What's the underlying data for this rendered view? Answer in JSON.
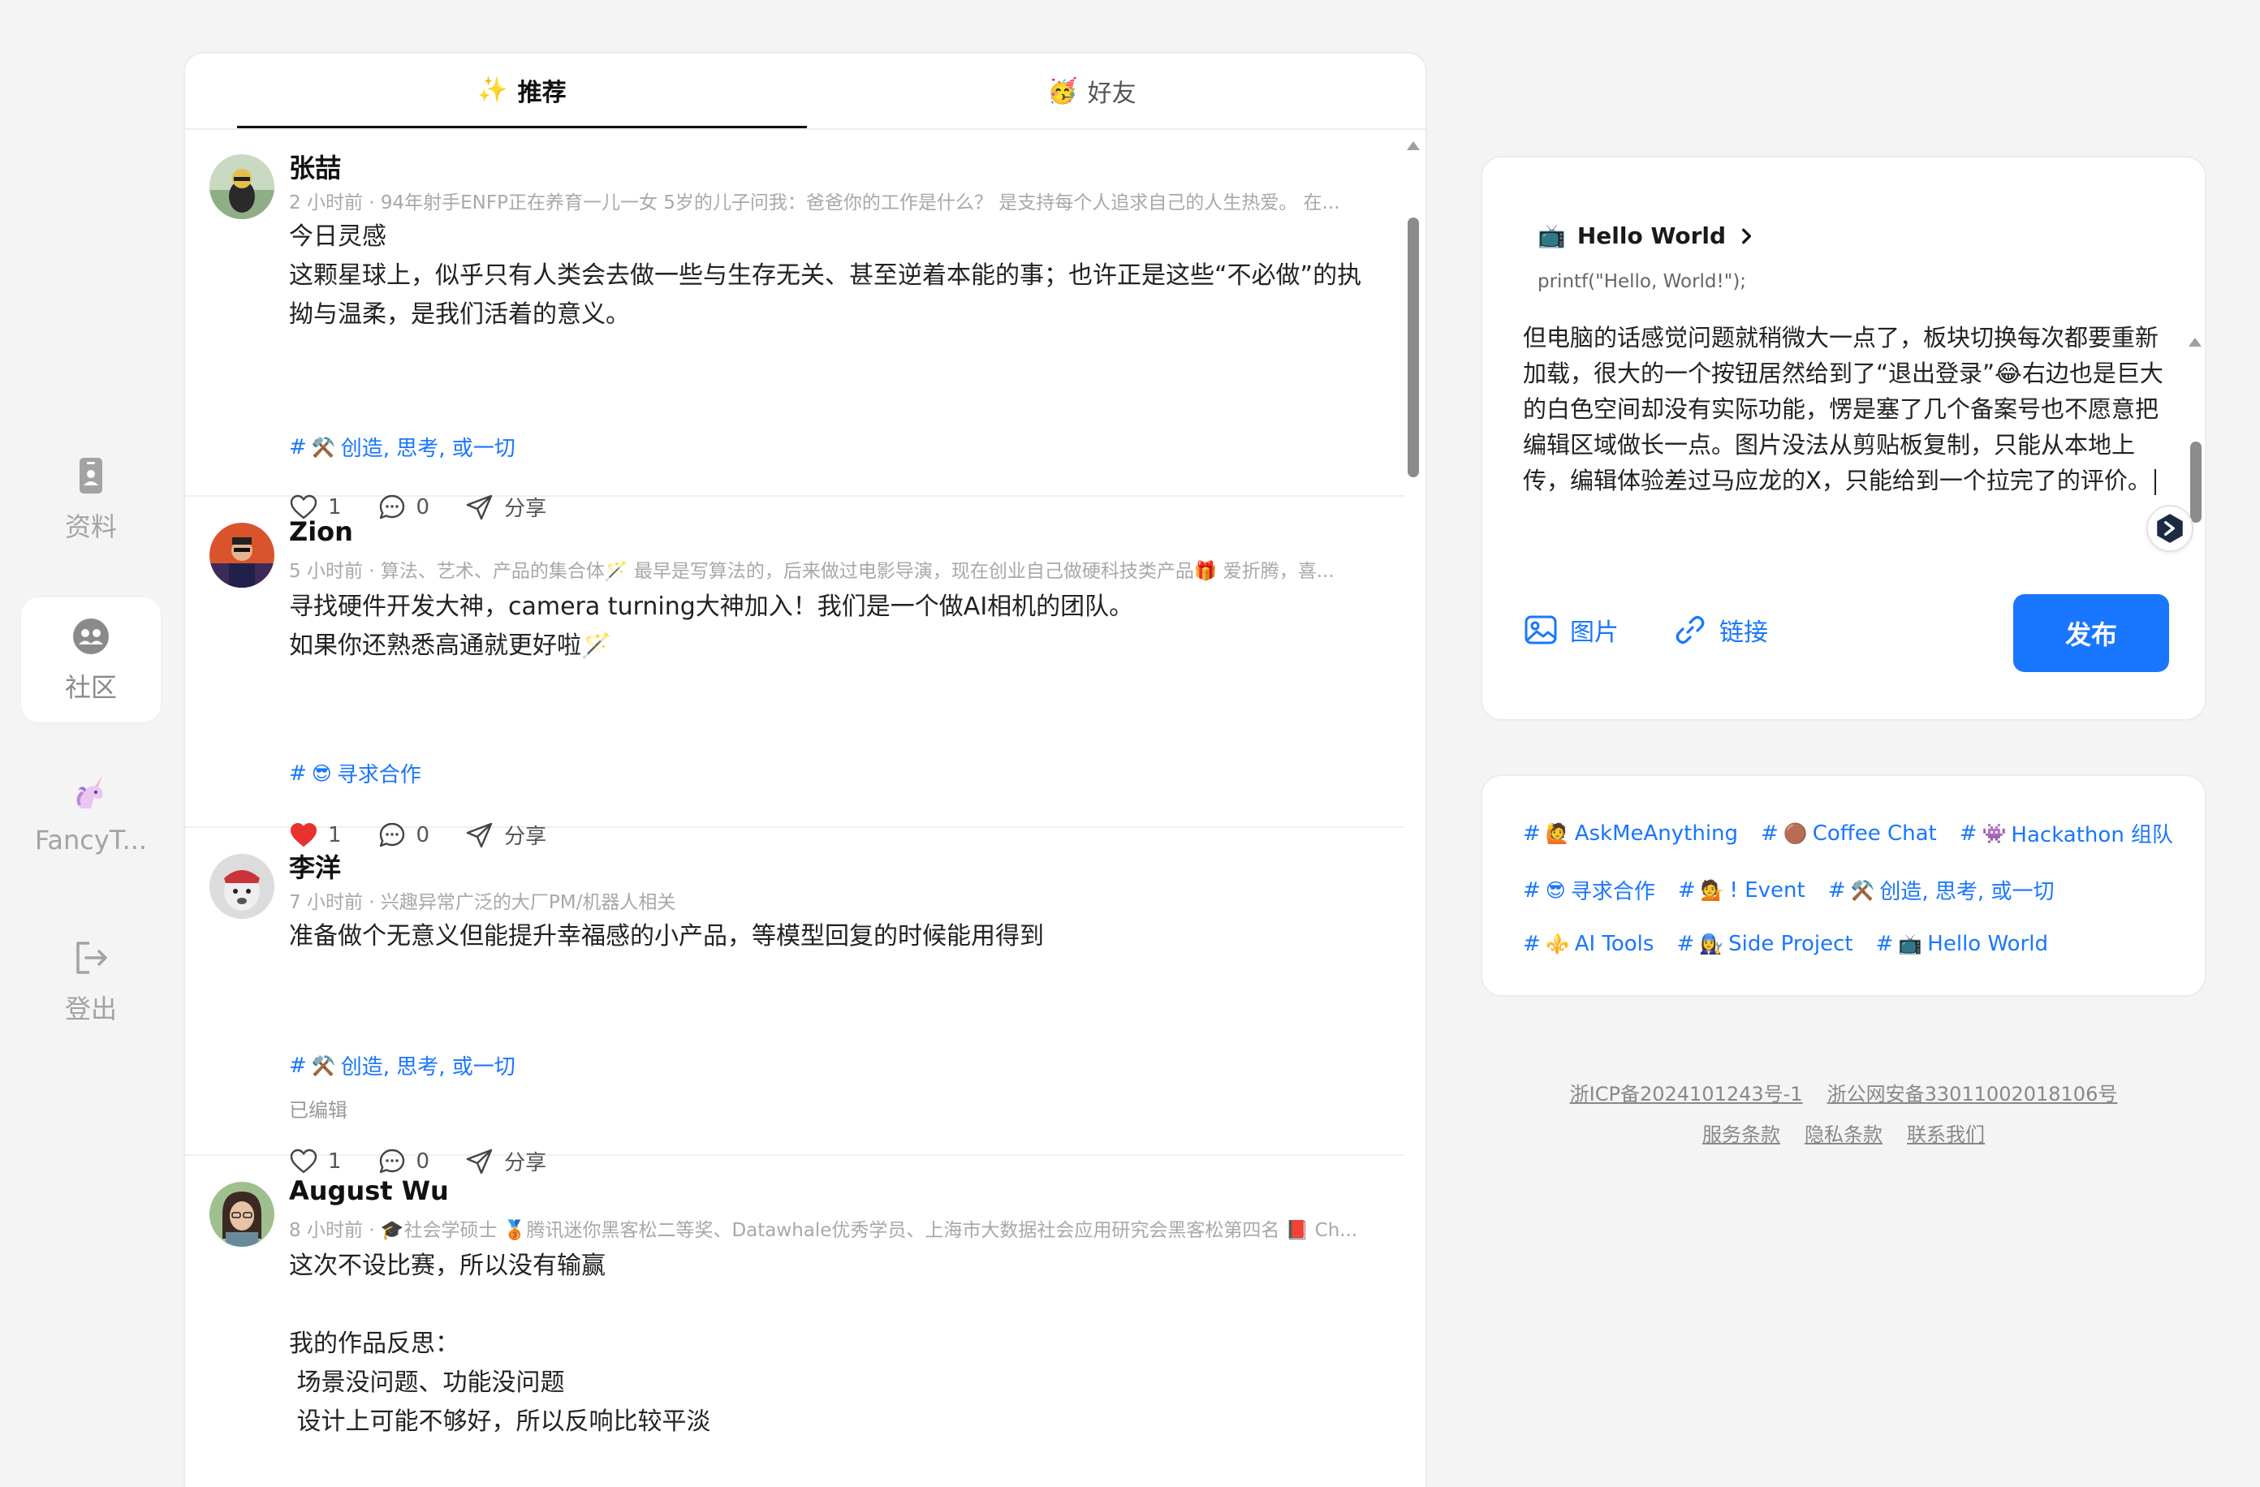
{
  "nav": [
    {
      "label": "资料",
      "icon": "id-badge-icon",
      "active": false
    },
    {
      "label": "社区",
      "icon": "community-icon",
      "active": true
    },
    {
      "label": "FancyT...",
      "icon": "unicorn-icon",
      "active": false
    },
    {
      "label": "登出",
      "icon": "logout-icon",
      "active": false
    }
  ],
  "tabs": [
    {
      "emoji": "✨",
      "label": "推荐",
      "active": true
    },
    {
      "emoji": "🥳",
      "label": "好友",
      "active": false
    }
  ],
  "posts": [
    {
      "name": "张喆",
      "meta": "2 小时前 · 94年射手ENFP正在养育一儿一女 5岁的儿子问我：爸爸你的工作是什么？ 是支持每个人追求自己的人生热爱。 在...",
      "body": "今日灵感\n这颗星球上，似乎只有人类会去做一些与生存无关、甚至逆着本能的事；也许正是这些“不必做”的执拗与温柔，是我们活着的意义。",
      "tag_emoji": "⚒️",
      "tag": "创造, 思考, 或一切",
      "likes": "1",
      "comments": "0",
      "share": "分享",
      "liked": false
    },
    {
      "name": "Zion",
      "meta": "5 小时前 · 算法、艺术、产品的集合体🪄 最早是写算法的，后来做过电影导演，现在创业自己做硬科技类产品🎁 爱折腾，喜...",
      "body": "寻找硬件开发大神，camera turning大神加入！我们是一个做AI相机的团队。\n如果你还熟悉高通就更好啦🪄",
      "tag_emoji": "😎",
      "tag": "寻求合作",
      "likes": "1",
      "comments": "0",
      "share": "分享",
      "liked": true
    },
    {
      "name": "李洋",
      "meta": "7 小时前 · 兴趣异常广泛的大厂PM/机器人相关",
      "body": "准备做个无意义但能提升幸福感的小产品，等模型回复的时候能用得到",
      "tag_emoji": "⚒️",
      "tag": "创造, 思考, 或一切",
      "edited": "已编辑",
      "likes": "1",
      "comments": "0",
      "share": "分享",
      "liked": false
    },
    {
      "name": "August Wu",
      "meta": "8 小时前 · 🎓社会学硕士 🥉腾讯迷你黑客松二等奖、Datawhale优秀学员、上海市大数据社会应用研究会黑客松第四名 📕 Ch...",
      "body": "这次不设比赛，所以没有输赢\n\n我的作品反思：\n 场景没问题、功能没问题\n 设计上可能不够好，所以反响比较平淡"
    }
  ],
  "composer": {
    "channel_emoji": "📺",
    "channel": "Hello World",
    "subtitle": "printf(\"Hello, World!\");",
    "text": "但电脑的话感觉问题就稍微大一点了，板块切换每次都要重新加载，很大的一个按钮居然给到了“退出登录”😂右边也是巨大的白色空间却没有实际功能，愣是塞了几个备案号也不愿意把编辑区域做长一点。图片没法从剪贴板复制，只能从本地上传，编辑体验差过马应龙的X，只能给到一个拉完了的评价。",
    "image_btn": "图片",
    "link_btn": "链接",
    "publish": "发布"
  },
  "tag_rows": [
    [
      {
        "emoji": "🙋",
        "label": "AskMeAnything"
      },
      {
        "emoji": "🟤",
        "label": "Coffee Chat"
      },
      {
        "emoji": "👾",
        "label": "Hackathon 组队"
      }
    ],
    [
      {
        "emoji": "😎",
        "label": "寻求合作"
      },
      {
        "emoji": "💁",
        "label": "! Event"
      },
      {
        "emoji": "⚒️",
        "label": "创造, 思考, 或一切"
      }
    ],
    [
      {
        "emoji": "⚜️",
        "label": "AI Tools"
      },
      {
        "emoji": "👩‍🔧",
        "label": "Side Project"
      },
      {
        "emoji": "📺",
        "label": "Hello World"
      }
    ]
  ],
  "footer": {
    "icp": "浙ICP备2024101243号-1",
    "police": "浙公网安备33011002018106号",
    "terms": "服务条款",
    "privacy": "隐私条款",
    "contact": "联系我们"
  },
  "colors": {
    "accent": "#1976ff",
    "like_red": "#e8322e"
  }
}
